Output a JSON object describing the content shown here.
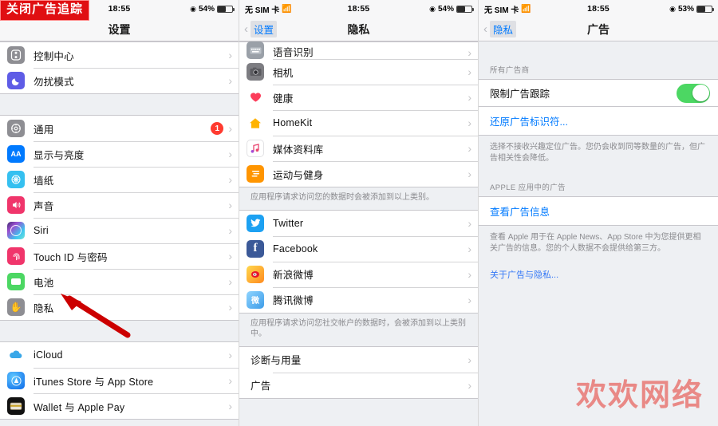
{
  "banner": {
    "text": "关闭广告追踪"
  },
  "watermark": {
    "text": "欢欢网络",
    "color": "#e8736f"
  },
  "screens": [
    {
      "status": {
        "carrier": "",
        "wifi": "",
        "time": "18:55",
        "battery": "54%"
      },
      "nav": {
        "back": "",
        "title": "设置"
      },
      "sections": [
        {
          "type": "list",
          "rows": [
            {
              "label": "控制中心",
              "icon": "control-center-icon",
              "color": "#8e8e93"
            },
            {
              "label": "勿扰模式",
              "icon": "moon-icon",
              "color": "#5e5ce6"
            }
          ]
        },
        {
          "type": "gap"
        },
        {
          "type": "list",
          "rows": [
            {
              "label": "通用",
              "icon": "gear-icon",
              "color": "#8e8e93",
              "badge": "1"
            },
            {
              "label": "显示与亮度",
              "icon": "aa-icon",
              "color": "#007aff"
            },
            {
              "label": "墙纸",
              "icon": "wallpaper-icon",
              "color": "#35c0f0"
            },
            {
              "label": "声音",
              "icon": "speaker-icon",
              "color": "#f0356b"
            },
            {
              "label": "Siri",
              "icon": "siri-icon",
              "color": "#6a38c2"
            },
            {
              "label": "Touch ID 与密码",
              "icon": "fingerprint-icon",
              "color": "#f0356b"
            },
            {
              "label": "电池",
              "icon": "battery-icon",
              "color": "#4cd763"
            },
            {
              "label": "隐私",
              "icon": "hand-icon",
              "color": "#8e8e93"
            }
          ]
        },
        {
          "type": "gap"
        },
        {
          "type": "list",
          "rows": [
            {
              "label": "iCloud",
              "icon": "cloud-icon",
              "color": "#ffffff"
            },
            {
              "label": "iTunes Store 与 App Store",
              "icon": "appstore-icon",
              "color": "#1b7df5"
            },
            {
              "label": "Wallet 与 Apple Pay",
              "icon": "wallet-icon",
              "color": "#111111"
            }
          ]
        }
      ]
    },
    {
      "status": {
        "carrier": "无 SIM 卡",
        "wifi": "",
        "time": "18:55",
        "battery": "54%"
      },
      "nav": {
        "back": "设置",
        "title": "隐私"
      },
      "sections": [
        {
          "type": "list",
          "rows": [
            {
              "label": "语音识别",
              "icon": "keyboard-icon",
              "color": "#9aa0a8",
              "partial": true
            },
            {
              "label": "相机",
              "icon": "camera-icon",
              "color": "#7d7d82"
            },
            {
              "label": "健康",
              "icon": "heart-icon",
              "color": "#ffffff"
            },
            {
              "label": "HomeKit",
              "icon": "home-icon",
              "color": "#ffb300"
            },
            {
              "label": "媒体资料库",
              "icon": "music-icon",
              "color": "#ffffff"
            },
            {
              "label": "运动与健身",
              "icon": "fitness-icon",
              "color": "#ff9500"
            }
          ]
        },
        {
          "type": "note",
          "text": "应用程序请求访问您的数据时会被添加到以上类别。"
        },
        {
          "type": "list",
          "rows": [
            {
              "label": "Twitter",
              "icon": "twitter-icon",
              "color": "#1da1f2"
            },
            {
              "label": "Facebook",
              "icon": "facebook-icon",
              "color": "#3b5998"
            },
            {
              "label": "新浪微博",
              "icon": "weibo-icon",
              "color": "#e6162d"
            },
            {
              "label": "腾讯微博",
              "icon": "tencent-weibo-icon",
              "color": "#4aa8e8"
            }
          ]
        },
        {
          "type": "note",
          "text": "应用程序请求访问您社交帐户的数据时，会被添加到以上类别中。"
        },
        {
          "type": "list",
          "rows": [
            {
              "label": "诊断与用量",
              "icon": "",
              "color": ""
            },
            {
              "label": "广告",
              "icon": "",
              "color": ""
            }
          ]
        }
      ]
    },
    {
      "status": {
        "carrier": "无 SIM 卡",
        "wifi": "",
        "time": "18:55",
        "battery": "53%"
      },
      "nav": {
        "back": "隐私",
        "title": "广告"
      },
      "section_header": "所有广告商",
      "toggle": {
        "label": "限制广告跟踪",
        "state": "on",
        "color": "#4cd763"
      },
      "reset_link": "还原广告标识符...",
      "note1": "选择不接收兴趣定位广告。您仍会收到同等数量的广告，但广告相关性会降低。",
      "section_header2": "APPLE 应用中的广告",
      "view_link": "查看广告信息",
      "note2": "查看 Apple 用于在 Apple News、App Store 中为您提供更相关广告的信息。您的个人数据不会提供给第三方。",
      "about_link": "关于广告与隐私..."
    }
  ]
}
